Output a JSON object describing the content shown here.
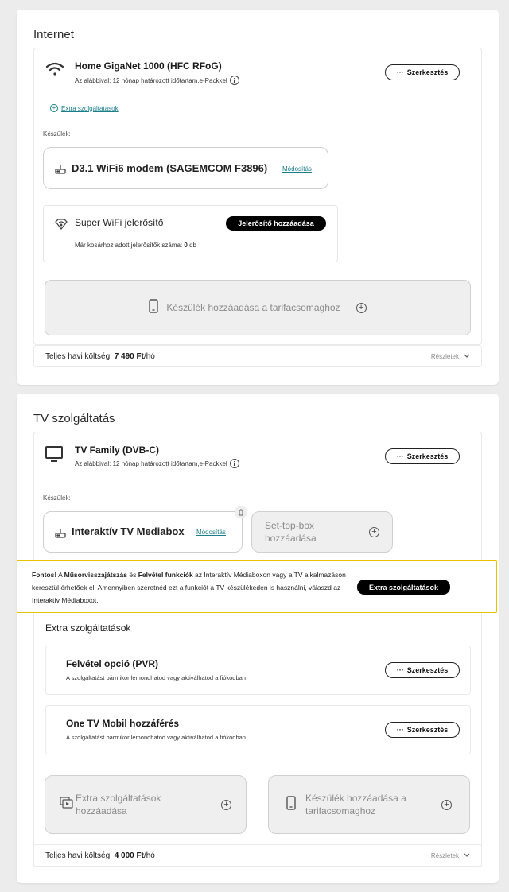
{
  "internet": {
    "title": "Internet",
    "service": {
      "name": "Home GigaNet 1000 (HFC RFoG)",
      "subtitle": "Az alábbival: 12 hónap határozott időtartam,e-Packkel",
      "edit_label": "Szerkesztés",
      "extra_link": "Extra szolgáltatások",
      "icon": "wifi-icon"
    },
    "device_label": "Készülék:",
    "device": {
      "name": "D3.1 WiFi6 modem (SAGEMCOM F3896)",
      "modify_label": "Módosítás",
      "icon": "router-icon"
    },
    "booster": {
      "name": "Super WiFi jelerősítő",
      "add_label": "Jelerősítő hozzáadása",
      "count_prefix": "Már kosárhoz adott jelerősítők száma:",
      "count_value": "0",
      "count_unit": "db",
      "icon": "wifi-diamond-icon"
    },
    "add_device_label": "Készülék hozzáadása a tarifacsomaghoz",
    "footer": {
      "label": "Teljes havi költség:",
      "amount": "7 490 Ft",
      "unit": "/hó",
      "details": "Részletek"
    }
  },
  "tv": {
    "title": "TV szolgáltatás",
    "service": {
      "name": "TV Family (DVB-C)",
      "subtitle": "Az alábbival: 12 hónap határozott időtartam,e-Packkel",
      "edit_label": "Szerkesztés",
      "icon": "tv-icon"
    },
    "device_label": "Készülék:",
    "device": {
      "name": "Interaktív TV Mediabox",
      "modify_label": "Módosítás",
      "icon": "router-icon"
    },
    "stb_add_label": "Set-top-box hozzáadása",
    "notice": {
      "t1": "Fontos!",
      "t2": " A ",
      "t3": "Műsorvisszajátszás",
      "t4": " és ",
      "t5": "Felvétel funkciók",
      "t6": " az Interaktív Médiaboxon vagy a TV alkalmazáson keresztül érhetőek el. Amennyiben szeretnéd ezt a funkciót a TV készülékeden is használni, válaszd az Interaktív Médiaboxot.",
      "button": "Extra szolgáltatások"
    },
    "extras_title": "Extra szolgáltatások",
    "extras": [
      {
        "name": "Felvétel opció (PVR)",
        "desc": "A szolgáltatást bármikor lemondhatod vagy aktiválhatod a fiókodban",
        "edit_label": "Szerkesztés"
      },
      {
        "name": "One TV Mobil hozzáférés",
        "desc": "A szolgáltatást bármikor lemondhatod vagy aktiválhatod a fiókodban",
        "edit_label": "Szerkesztés"
      }
    ],
    "add_extra_label": "Extra szolgáltatások hozzáadása",
    "add_device_label": "Készülék hozzáadása a tarifacsomaghoz",
    "footer": {
      "label": "Teljes havi költség:",
      "amount": "4 000 Ft",
      "unit": "/hó",
      "details": "Részletek"
    }
  },
  "colors": {
    "accent_link": "#1a7f8a",
    "notice_border": "#e6c200",
    "button_black": "#000000"
  }
}
